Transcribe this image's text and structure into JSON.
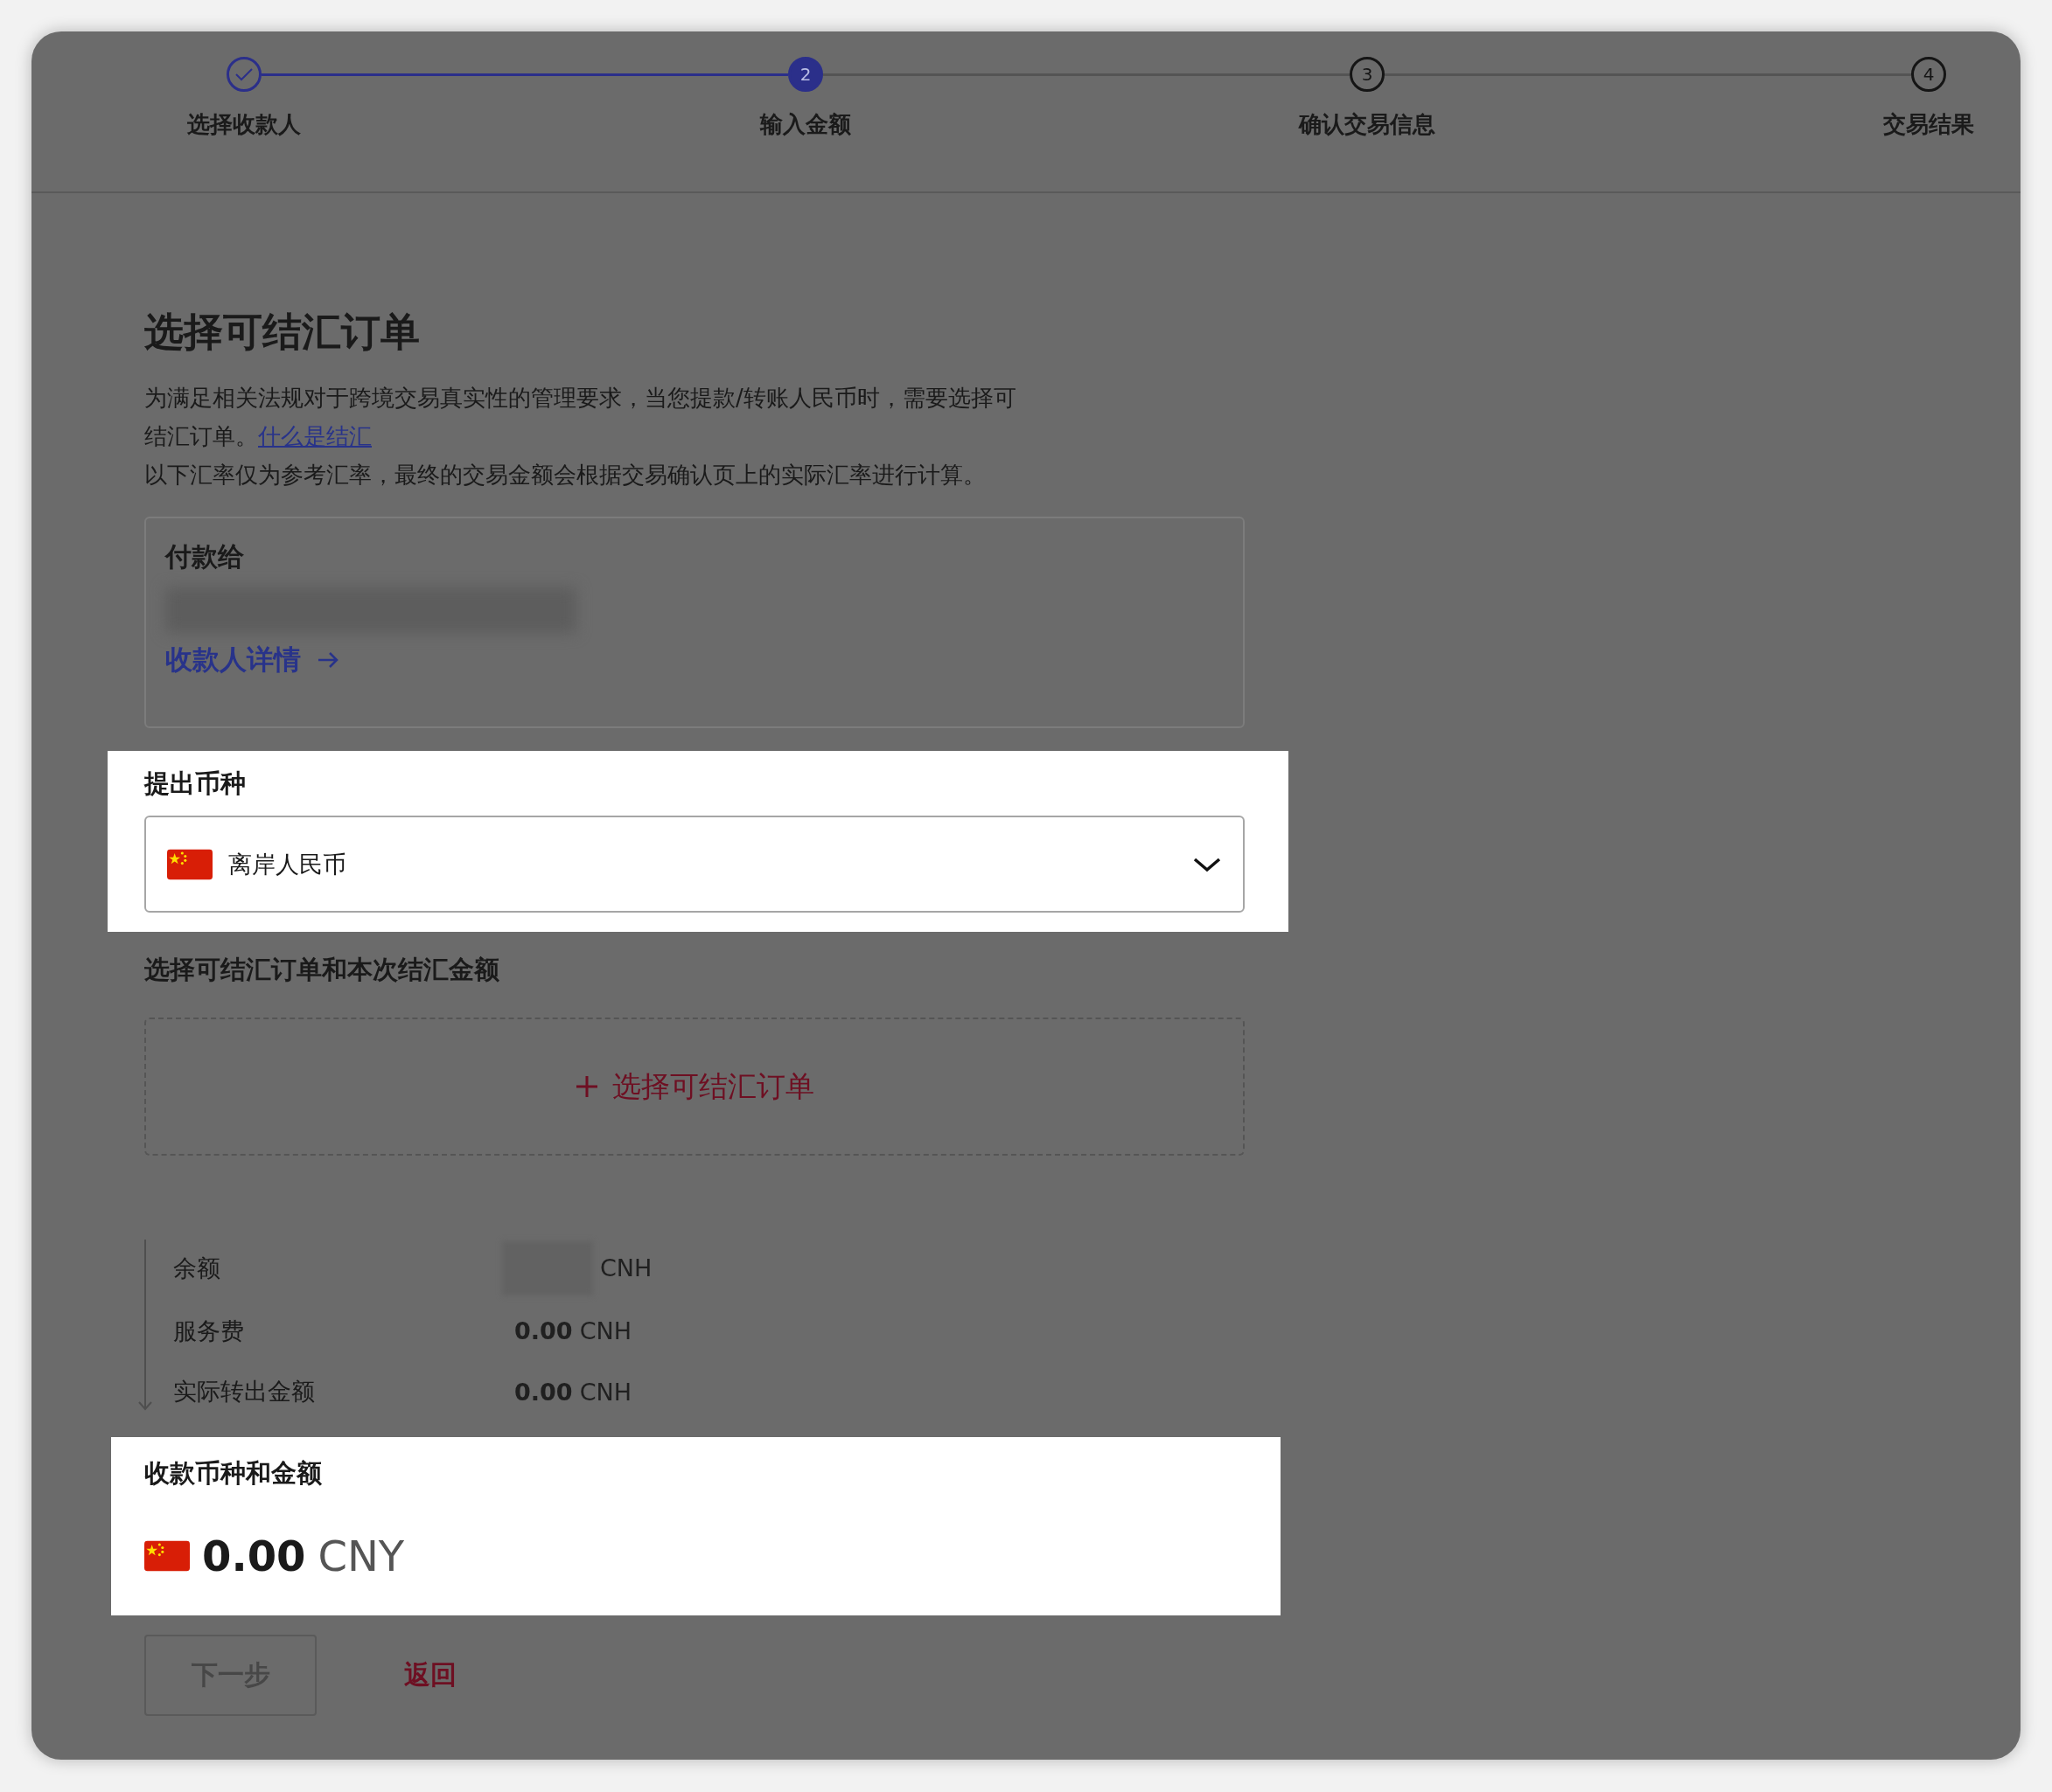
{
  "stepper": {
    "steps": [
      {
        "label": "选择收款人",
        "completed": true,
        "selected": false
      },
      {
        "label": "输入金额",
        "number": "2",
        "completed": false,
        "selected": true
      },
      {
        "label": "确认交易信息",
        "number": "3",
        "completed": false,
        "selected": false
      },
      {
        "label": "交易结果",
        "number": "4",
        "completed": false,
        "selected": false
      }
    ]
  },
  "title": "选择可结汇订单",
  "description": {
    "text": "为满足相关法规对于跨境交易真实性的管理要求，当您提款/转账人民币时，需要选择可结汇订单。",
    "link": "什么是结汇",
    "note": "以下汇率仅为参考汇率，最终的交易金额会根据交易确认页上的实际汇率进行计算。"
  },
  "payee_card": {
    "title": "付款给",
    "details_link": "收款人详情"
  },
  "withdraw_currency": {
    "label": "提出币种",
    "value": "离岸人民币",
    "highlighted": true
  },
  "orders": {
    "label": "选择可结汇订单和本次结汇金额",
    "add_button": "选择可结汇订单"
  },
  "summary": [
    {
      "label": "余额",
      "amount_hidden": true,
      "currency": "CNH"
    },
    {
      "label": "服务费",
      "amount": "0.00",
      "currency": "CNH"
    },
    {
      "label": "实际转出金额",
      "amount": "0.00",
      "currency": "CNH"
    }
  ],
  "receive": {
    "label": "收款币种和金额",
    "amount": "0.00",
    "currency": "CNY",
    "highlighted": true
  },
  "buttons": [
    {
      "label": "下一步",
      "kind": "primary",
      "disabled": true
    },
    {
      "label": "返回",
      "kind": "link"
    }
  ]
}
